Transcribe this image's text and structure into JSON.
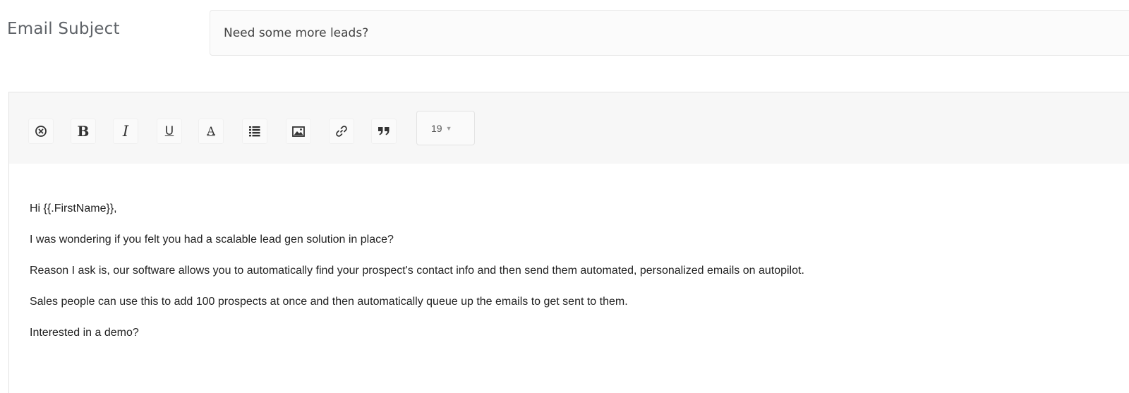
{
  "subject": {
    "label": "Email Subject",
    "value": "Need some more leads?"
  },
  "toolbar": {
    "buttons": [
      {
        "icon": "remove-format-icon",
        "glyph": "⊗"
      },
      {
        "icon": "bold-icon",
        "glyph": "B"
      },
      {
        "icon": "italic-icon",
        "glyph": "I"
      },
      {
        "icon": "underline-icon",
        "glyph": "U"
      },
      {
        "icon": "font-color-icon",
        "glyph": "A"
      },
      {
        "icon": "list-icon"
      },
      {
        "icon": "image-icon"
      },
      {
        "icon": "link-icon"
      },
      {
        "icon": "quote-icon",
        "glyph": "❞"
      }
    ],
    "font_size": "19"
  },
  "body": {
    "paragraphs": [
      "Hi {{.FirstName}},",
      "I was wondering if you felt you had a scalable lead gen solution in place?",
      "Reason I ask is, our software allows you to automatically find your prospect's contact info and then send them automated, personalized emails on autopilot.",
      "Sales people can use this to add 100 prospects at once and then automatically queue up the emails to get sent to them.",
      "Interested in a demo?"
    ]
  }
}
